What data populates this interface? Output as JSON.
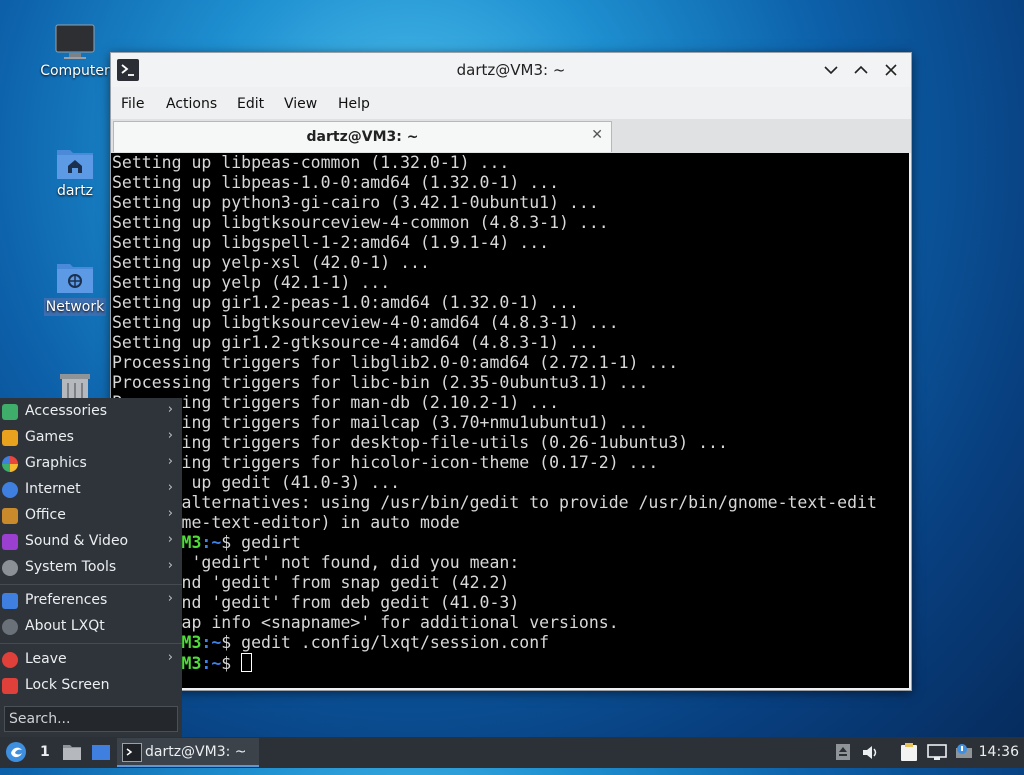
{
  "desktop": {
    "icons": [
      {
        "label": "Computer"
      },
      {
        "label": "dartz"
      },
      {
        "label": "Network"
      },
      {
        "label": "Trash"
      }
    ]
  },
  "window": {
    "title": "dartz@VM3: ~",
    "menu": [
      "File",
      "Actions",
      "Edit",
      "View",
      "Help"
    ],
    "tab_title": "dartz@VM3: ~",
    "terminal": {
      "lines": [
        "Setting up libpeas-common (1.32.0-1) ...",
        "Setting up libpeas-1.0-0:amd64 (1.32.0-1) ...",
        "Setting up python3-gi-cairo (3.42.1-0ubuntu1) ...",
        "Setting up libgtksourceview-4-common (4.8.3-1) ...",
        "Setting up libgspell-1-2:amd64 (1.9.1-4) ...",
        "Setting up yelp-xsl (42.0-1) ...",
        "Setting up yelp (42.1-1) ...",
        "Setting up gir1.2-peas-1.0:amd64 (1.32.0-1) ...",
        "Setting up libgtksourceview-4-0:amd64 (4.8.3-1) ...",
        "Setting up gir1.2-gtksource-4:amd64 (4.8.3-1) ...",
        "Processing triggers for libglib2.0-0:amd64 (2.72.1-1) ...",
        "Processing triggers for libc-bin (2.35-0ubuntu3.1) ...",
        "Processing triggers for man-db (2.10.2-1) ...",
        "Processing triggers for mailcap (3.70+nmu1ubuntu1) ...",
        "Processing triggers for desktop-file-utils (0.26-1ubuntu3) ...",
        "Processing triggers for hicolor-icon-theme (0.17-2) ...",
        "Setting up gedit (41.0-3) ...",
        "update-alternatives: using /usr/bin/gedit to provide /usr/bin/gnome-text-edit",
        "or (gnome-text-editor) in auto mode"
      ],
      "prompt_user": "dartz@VM3",
      "prompt_path": ":~",
      "prompt_symbol": "$ ",
      "command1": "gedirt",
      "output1": [
        "Command 'gedirt' not found, did you mean:",
        "  command 'gedit' from snap gedit (42.2)",
        "  command 'gedit' from deb gedit (41.0-3)",
        "See 'snap info <snapname>' for additional versions."
      ],
      "command2": "gedit .config/lxqt/session.conf"
    }
  },
  "start_menu": {
    "categories": [
      {
        "label": "Accessories",
        "icon": "accessories-icon",
        "color": "#3fae6a"
      },
      {
        "label": "Games",
        "icon": "games-icon",
        "color": "#e8a21e"
      },
      {
        "label": "Graphics",
        "icon": "graphics-icon",
        "color": "#d94a8c"
      },
      {
        "label": "Internet",
        "icon": "internet-icon",
        "color": "#3e7fe0"
      },
      {
        "label": "Office",
        "icon": "office-icon",
        "color": "#c98a2c"
      },
      {
        "label": "Sound & Video",
        "icon": "sound-video-icon",
        "color": "#9b3fd1"
      },
      {
        "label": "System Tools",
        "icon": "system-tools-icon",
        "color": "#8a9096"
      }
    ],
    "preferences": "Preferences",
    "about": "About LXQt",
    "leave": "Leave",
    "lock": "Lock Screen",
    "search_placeholder": "Search..."
  },
  "taskbar": {
    "desktop_number": "1",
    "task_label": "dartz@VM3: ~",
    "clock": "14:36"
  },
  "colors": {
    "accent": "#5e96d8",
    "prompt_user": "#4fdc3a",
    "prompt_path": "#3c82e8"
  }
}
